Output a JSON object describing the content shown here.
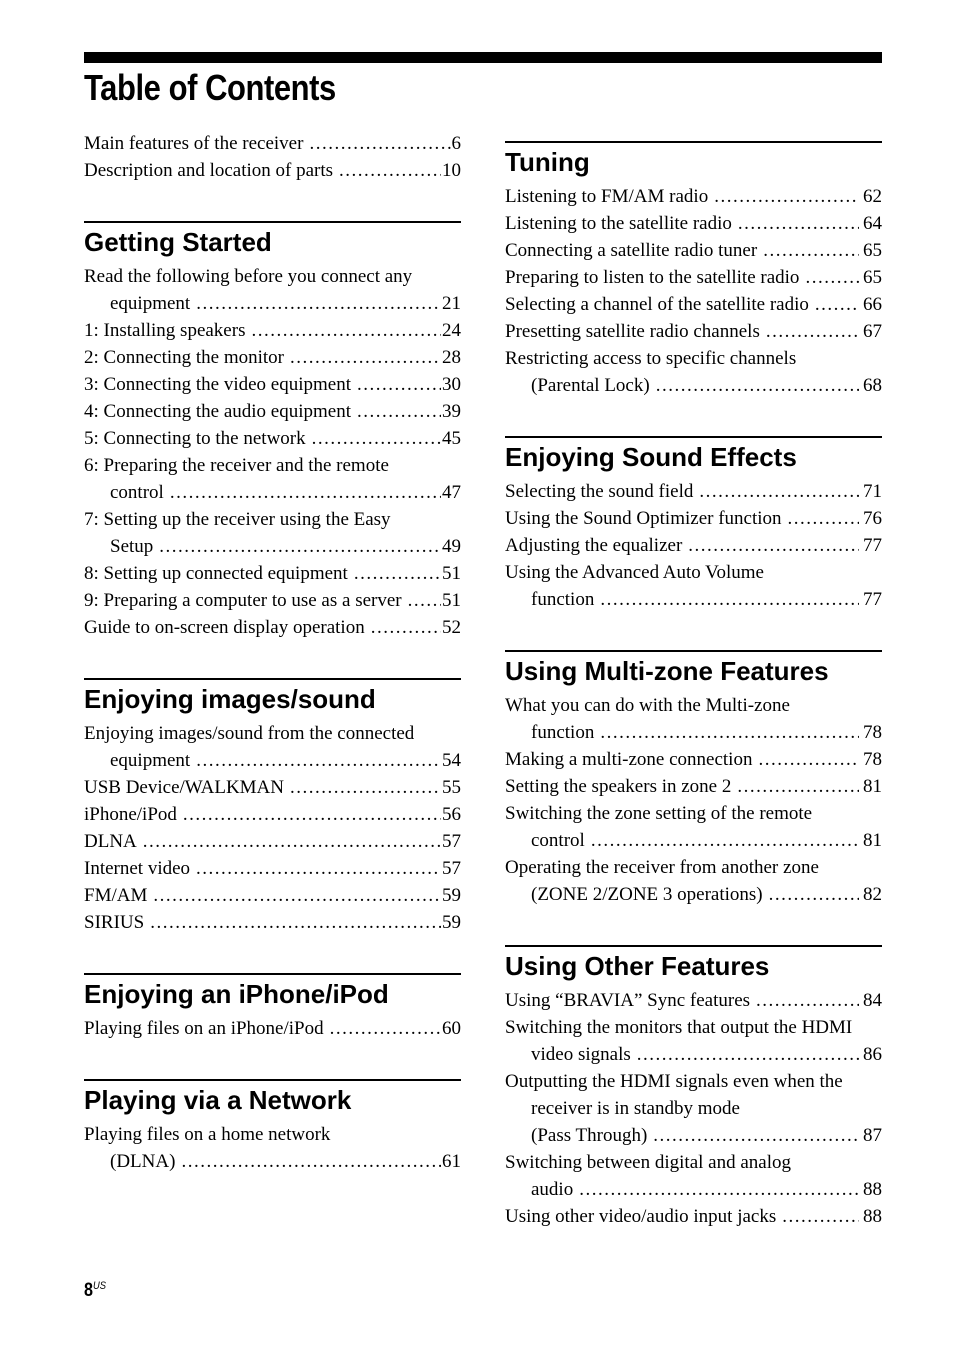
{
  "page": {
    "title": "Table of Contents",
    "folio_number": "8",
    "folio_suffix": "US"
  },
  "intro": [
    {
      "label": "Main features of the receiver",
      "page": "6"
    },
    {
      "label": "Description and location of parts",
      "page": "10"
    }
  ],
  "left_sections": [
    {
      "heading": "Getting Started",
      "entries": [
        {
          "label": "Read the following before you connect any",
          "cont": "equipment",
          "page": "21"
        },
        {
          "label": "1: Installing speakers",
          "page": "24"
        },
        {
          "label": "2: Connecting the monitor",
          "page": "28"
        },
        {
          "label": "3: Connecting the video equipment",
          "page": "30"
        },
        {
          "label": "4: Connecting the audio equipment",
          "page": "39"
        },
        {
          "label": "5: Connecting to the network",
          "page": "45"
        },
        {
          "label": "6: Preparing the receiver and the remote",
          "cont": "control",
          "page": "47"
        },
        {
          "label": "7: Setting up the receiver using the Easy",
          "cont": "Setup",
          "page": "49"
        },
        {
          "label": "8: Setting up connected equipment",
          "page": "51"
        },
        {
          "label": "9: Preparing a computer to use as a server",
          "page": "51"
        },
        {
          "label": "Guide to on-screen display operation",
          "page": "52"
        }
      ]
    },
    {
      "heading": "Enjoying images/sound",
      "entries": [
        {
          "label": "Enjoying images/sound from the connected",
          "cont": "equipment",
          "page": "54"
        },
        {
          "label": "USB Device/WALKMAN",
          "page": "55"
        },
        {
          "label": "iPhone/iPod",
          "page": "56"
        },
        {
          "label": "DLNA",
          "page": "57"
        },
        {
          "label": "Internet video",
          "page": "57"
        },
        {
          "label": "FM/AM",
          "page": "59"
        },
        {
          "label": "SIRIUS",
          "page": "59"
        }
      ]
    },
    {
      "heading": "Enjoying an iPhone/iPod",
      "entries": [
        {
          "label": "Playing files on an iPhone/iPod",
          "page": "60"
        }
      ]
    },
    {
      "heading": "Playing via a Network",
      "entries": [
        {
          "label": "Playing files on a home network",
          "cont": "(DLNA)",
          "page": "61"
        }
      ]
    }
  ],
  "right_sections": [
    {
      "heading": "Tuning",
      "entries": [
        {
          "label": "Listening to FM/AM radio",
          "page": "62"
        },
        {
          "label": "Listening to the satellite radio",
          "page": "64"
        },
        {
          "label": "Connecting a satellite radio tuner",
          "page": "65"
        },
        {
          "label": "Preparing to listen to the satellite radio",
          "page": "65"
        },
        {
          "label": "Selecting a channel of the satellite radio",
          "page": "66"
        },
        {
          "label": "Presetting satellite radio channels",
          "page": "67"
        },
        {
          "label": "Restricting access to specific channels",
          "cont": "(Parental Lock)",
          "page": "68"
        }
      ]
    },
    {
      "heading": "Enjoying Sound Effects",
      "entries": [
        {
          "label": "Selecting the sound field",
          "page": "71"
        },
        {
          "label": "Using the Sound Optimizer function",
          "page": "76"
        },
        {
          "label": "Adjusting the equalizer",
          "page": "77"
        },
        {
          "label": "Using the Advanced Auto Volume",
          "cont": "function",
          "page": "77"
        }
      ]
    },
    {
      "heading": "Using Multi-zone Features",
      "entries": [
        {
          "label": "What you can do with the Multi-zone",
          "cont": "function",
          "page": "78"
        },
        {
          "label": "Making a multi-zone connection",
          "page": "78"
        },
        {
          "label": "Setting the speakers in zone 2",
          "page": "81"
        },
        {
          "label": "Switching the zone setting of the remote",
          "cont": "control",
          "page": "81"
        },
        {
          "label": "Operating the receiver from another zone",
          "cont": "(ZONE 2/ZONE 3 operations)",
          "page": "82"
        }
      ]
    },
    {
      "heading": "Using Other Features",
      "entries": [
        {
          "label": "Using “BRAVIA” Sync features",
          "page": "84"
        },
        {
          "label": "Switching the monitors that output the HDMI",
          "cont": "video signals",
          "page": "86"
        },
        {
          "label": "Outputting the HDMI signals even when the",
          "cont2": "receiver is in standby mode",
          "cont": "(Pass Through)",
          "page": "87"
        },
        {
          "label": "Switching between digital and analog",
          "cont": "audio",
          "page": "88"
        },
        {
          "label": "Using other video/audio input jacks",
          "page": "88"
        }
      ]
    }
  ]
}
